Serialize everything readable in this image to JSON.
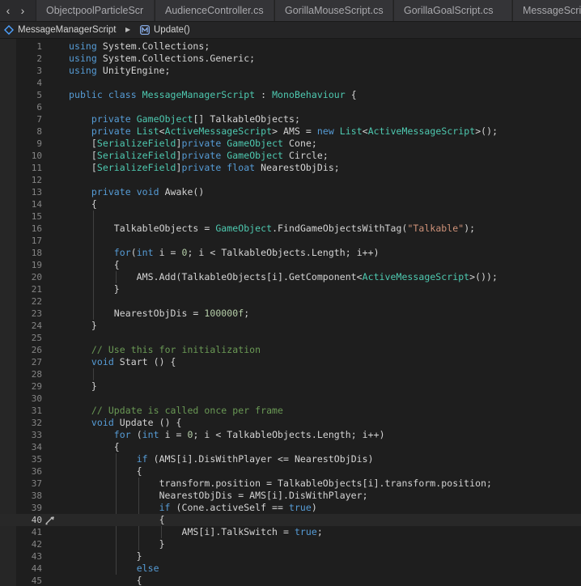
{
  "tabs": [
    {
      "label": "ObjectpoolParticleScr"
    },
    {
      "label": "AudienceController.cs"
    },
    {
      "label": "GorillaMouseScript.cs"
    },
    {
      "label": "GorillaGoalScript.cs"
    },
    {
      "label": "MessageScrip"
    }
  ],
  "nav": {
    "back": "‹",
    "forward": "›"
  },
  "breadcrumb": {
    "class_name": "MessageManagerScript",
    "method_name": "Update()",
    "separator": "▶"
  },
  "editor": {
    "current_line": 40,
    "lines": [
      {
        "n": 1,
        "tokens": [
          [
            "k",
            "using"
          ],
          [
            "p",
            " System.Collections;"
          ]
        ]
      },
      {
        "n": 2,
        "tokens": [
          [
            "k",
            "using"
          ],
          [
            "p",
            " System.Collections.Generic;"
          ]
        ]
      },
      {
        "n": 3,
        "tokens": [
          [
            "k",
            "using"
          ],
          [
            "p",
            " UnityEngine;"
          ]
        ]
      },
      {
        "n": 4,
        "tokens": []
      },
      {
        "n": 5,
        "tokens": [
          [
            "k",
            "public class "
          ],
          [
            "t",
            "MessageManagerScript"
          ],
          [
            "p",
            " : "
          ],
          [
            "t",
            "MonoBehaviour"
          ],
          [
            "p",
            " {"
          ]
        ]
      },
      {
        "n": 6,
        "tokens": []
      },
      {
        "n": 7,
        "tokens": [
          [
            "p",
            "    "
          ],
          [
            "k",
            "private "
          ],
          [
            "t",
            "GameObject"
          ],
          [
            "p",
            "[] TalkableObjects;"
          ]
        ]
      },
      {
        "n": 8,
        "tokens": [
          [
            "p",
            "    "
          ],
          [
            "k",
            "private "
          ],
          [
            "t",
            "List"
          ],
          [
            "p",
            "<"
          ],
          [
            "t",
            "ActiveMessageScript"
          ],
          [
            "p",
            "> AMS = "
          ],
          [
            "k",
            "new "
          ],
          [
            "t",
            "List"
          ],
          [
            "p",
            "<"
          ],
          [
            "t",
            "ActiveMessageScript"
          ],
          [
            "p",
            ">();"
          ]
        ]
      },
      {
        "n": 9,
        "tokens": [
          [
            "p",
            "    ["
          ],
          [
            "t",
            "SerializeField"
          ],
          [
            "p",
            "]"
          ],
          [
            "k",
            "private "
          ],
          [
            "t",
            "GameObject"
          ],
          [
            "p",
            " Cone;"
          ]
        ]
      },
      {
        "n": 10,
        "tokens": [
          [
            "p",
            "    ["
          ],
          [
            "t",
            "SerializeField"
          ],
          [
            "p",
            "]"
          ],
          [
            "k",
            "private "
          ],
          [
            "t",
            "GameObject"
          ],
          [
            "p",
            " Circle;"
          ]
        ]
      },
      {
        "n": 11,
        "tokens": [
          [
            "p",
            "    ["
          ],
          [
            "t",
            "SerializeField"
          ],
          [
            "p",
            "]"
          ],
          [
            "k",
            "private float"
          ],
          [
            "p",
            " NearestObjDis;"
          ]
        ]
      },
      {
        "n": 12,
        "tokens": []
      },
      {
        "n": 13,
        "tokens": [
          [
            "p",
            "    "
          ],
          [
            "k",
            "private void"
          ],
          [
            "p",
            " Awake()"
          ]
        ]
      },
      {
        "n": 14,
        "tokens": [
          [
            "p",
            "    {"
          ]
        ]
      },
      {
        "n": 15,
        "tokens": []
      },
      {
        "n": 16,
        "tokens": [
          [
            "p",
            "        TalkableObjects = "
          ],
          [
            "t",
            "GameObject"
          ],
          [
            "p",
            ".FindGameObjectsWithTag("
          ],
          [
            "s",
            "\"Talkable\""
          ],
          [
            "p",
            ");"
          ]
        ]
      },
      {
        "n": 17,
        "tokens": []
      },
      {
        "n": 18,
        "tokens": [
          [
            "p",
            "        "
          ],
          [
            "k",
            "for"
          ],
          [
            "p",
            "("
          ],
          [
            "k",
            "int"
          ],
          [
            "p",
            " i = "
          ],
          [
            "n",
            "0"
          ],
          [
            "p",
            "; i < TalkableObjects.Length; i++)"
          ]
        ]
      },
      {
        "n": 19,
        "tokens": [
          [
            "p",
            "        {"
          ]
        ]
      },
      {
        "n": 20,
        "tokens": [
          [
            "p",
            "            AMS.Add(TalkableObjects[i].GetComponent<"
          ],
          [
            "t",
            "ActiveMessageScript"
          ],
          [
            "p",
            ">());"
          ]
        ]
      },
      {
        "n": 21,
        "tokens": [
          [
            "p",
            "        }"
          ]
        ]
      },
      {
        "n": 22,
        "tokens": []
      },
      {
        "n": 23,
        "tokens": [
          [
            "p",
            "        NearestObjDis = "
          ],
          [
            "n",
            "100000f"
          ],
          [
            "p",
            ";"
          ]
        ]
      },
      {
        "n": 24,
        "tokens": [
          [
            "p",
            "    }"
          ]
        ]
      },
      {
        "n": 25,
        "tokens": []
      },
      {
        "n": 26,
        "tokens": [
          [
            "p",
            "    "
          ],
          [
            "c",
            "// Use this for initialization"
          ]
        ]
      },
      {
        "n": 27,
        "tokens": [
          [
            "p",
            "    "
          ],
          [
            "k",
            "void"
          ],
          [
            "p",
            " Start () {"
          ]
        ]
      },
      {
        "n": 28,
        "tokens": []
      },
      {
        "n": 29,
        "tokens": [
          [
            "p",
            "    }"
          ]
        ]
      },
      {
        "n": 30,
        "tokens": []
      },
      {
        "n": 31,
        "tokens": [
          [
            "p",
            "    "
          ],
          [
            "c",
            "// Update is called once per frame"
          ]
        ]
      },
      {
        "n": 32,
        "tokens": [
          [
            "p",
            "    "
          ],
          [
            "k",
            "void"
          ],
          [
            "p",
            " Update () {"
          ]
        ]
      },
      {
        "n": 33,
        "tokens": [
          [
            "p",
            "        "
          ],
          [
            "k",
            "for"
          ],
          [
            "p",
            " ("
          ],
          [
            "k",
            "int"
          ],
          [
            "p",
            " i = "
          ],
          [
            "n",
            "0"
          ],
          [
            "p",
            "; i < TalkableObjects.Length; i++)"
          ]
        ]
      },
      {
        "n": 34,
        "tokens": [
          [
            "p",
            "        {"
          ]
        ]
      },
      {
        "n": 35,
        "tokens": [
          [
            "p",
            "            "
          ],
          [
            "k",
            "if"
          ],
          [
            "p",
            " (AMS[i].DisWithPlayer <= NearestObjDis)"
          ]
        ]
      },
      {
        "n": 36,
        "tokens": [
          [
            "p",
            "            {"
          ]
        ]
      },
      {
        "n": 37,
        "tokens": [
          [
            "p",
            "                transform.position = TalkableObjects[i].transform.position;"
          ]
        ]
      },
      {
        "n": 38,
        "tokens": [
          [
            "p",
            "                NearestObjDis = AMS[i].DisWithPlayer;"
          ]
        ]
      },
      {
        "n": 39,
        "tokens": [
          [
            "p",
            "                "
          ],
          [
            "k",
            "if"
          ],
          [
            "p",
            " (Cone.activeSelf == "
          ],
          [
            "k",
            "true"
          ],
          [
            "p",
            ")"
          ]
        ]
      },
      {
        "n": 40,
        "tokens": [
          [
            "p",
            "                {"
          ]
        ]
      },
      {
        "n": 41,
        "tokens": [
          [
            "p",
            "                    AMS[i].TalkSwitch = "
          ],
          [
            "k",
            "true"
          ],
          [
            "p",
            ";"
          ]
        ]
      },
      {
        "n": 42,
        "tokens": [
          [
            "p",
            "                }"
          ]
        ]
      },
      {
        "n": 43,
        "tokens": [
          [
            "p",
            "            }"
          ]
        ]
      },
      {
        "n": 44,
        "tokens": [
          [
            "p",
            "            "
          ],
          [
            "k",
            "else"
          ]
        ]
      },
      {
        "n": 45,
        "tokens": [
          [
            "p",
            "            {"
          ]
        ]
      }
    ]
  },
  "colors": {
    "keyword": "#569cd6",
    "type": "#4ec9b0",
    "string": "#ce9178",
    "number": "#b5cea8",
    "comment": "#6a9955",
    "text": "#d4d4d4"
  },
  "icons": {
    "breadcrumb_class": "csharp-class-icon",
    "breadcrumb_method": "method-icon",
    "gutter": "edit-pencil-icon"
  }
}
